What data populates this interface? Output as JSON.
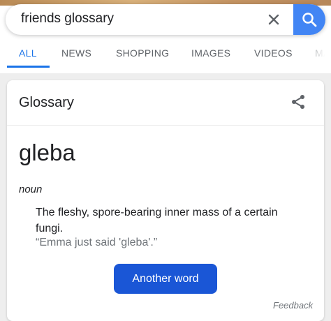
{
  "search": {
    "query": "friends glossary"
  },
  "icons": {
    "clear": "close-icon",
    "search": "search-icon",
    "share": "share-icon"
  },
  "tabs": [
    {
      "label": "ALL"
    },
    {
      "label": "NEWS"
    },
    {
      "label": "SHOPPING"
    },
    {
      "label": "IMAGES"
    },
    {
      "label": "VIDEOS"
    },
    {
      "label": "MA"
    }
  ],
  "card": {
    "title": "Glossary",
    "word": "gleba",
    "part_of_speech": "noun",
    "definition": "The fleshy, spore-bearing inner mass of a certain fungi.",
    "example": "“Emma just said 'gleba'.”",
    "button_label": "Another word",
    "feedback_label": "Feedback"
  },
  "colors": {
    "accent": "#1a73e8",
    "search_button": "#4285f4",
    "primary_button": "#1a56d6"
  }
}
